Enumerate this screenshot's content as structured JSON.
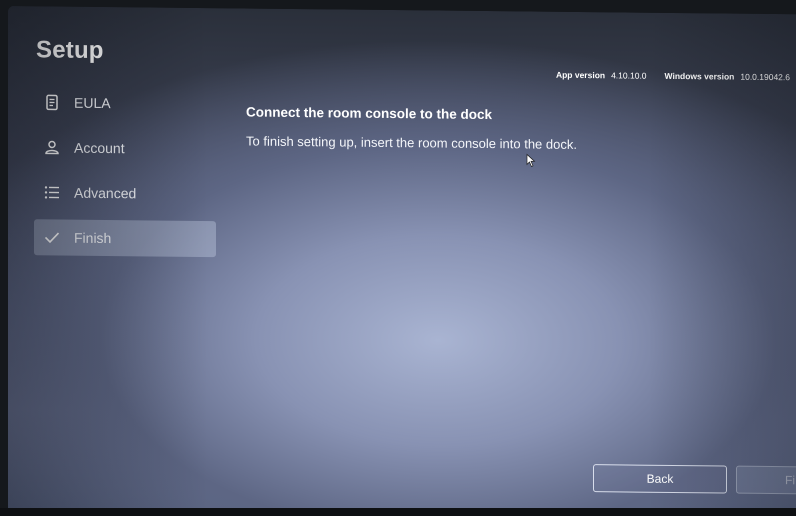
{
  "app": {
    "title": "Setup",
    "app_version_label": "App version",
    "app_version_value": "4.10.10.0",
    "windows_version_label": "Windows version",
    "windows_version_value": "10.0.19042.6"
  },
  "sidebar": {
    "items": [
      {
        "label": "EULA",
        "icon": "document-icon",
        "selected": false
      },
      {
        "label": "Account",
        "icon": "person-icon",
        "selected": false
      },
      {
        "label": "Advanced",
        "icon": "list-icon",
        "selected": false
      },
      {
        "label": "Finish",
        "icon": "checkmark-icon",
        "selected": true
      }
    ]
  },
  "main": {
    "heading": "Connect the room console to the dock",
    "body": "To finish setting up, insert the room console into the dock."
  },
  "footer": {
    "back_label": "Back",
    "finish_label": "Fi"
  },
  "colors": {
    "selected_nav_bg": "#c8d2e8",
    "text": "#ffffff"
  }
}
